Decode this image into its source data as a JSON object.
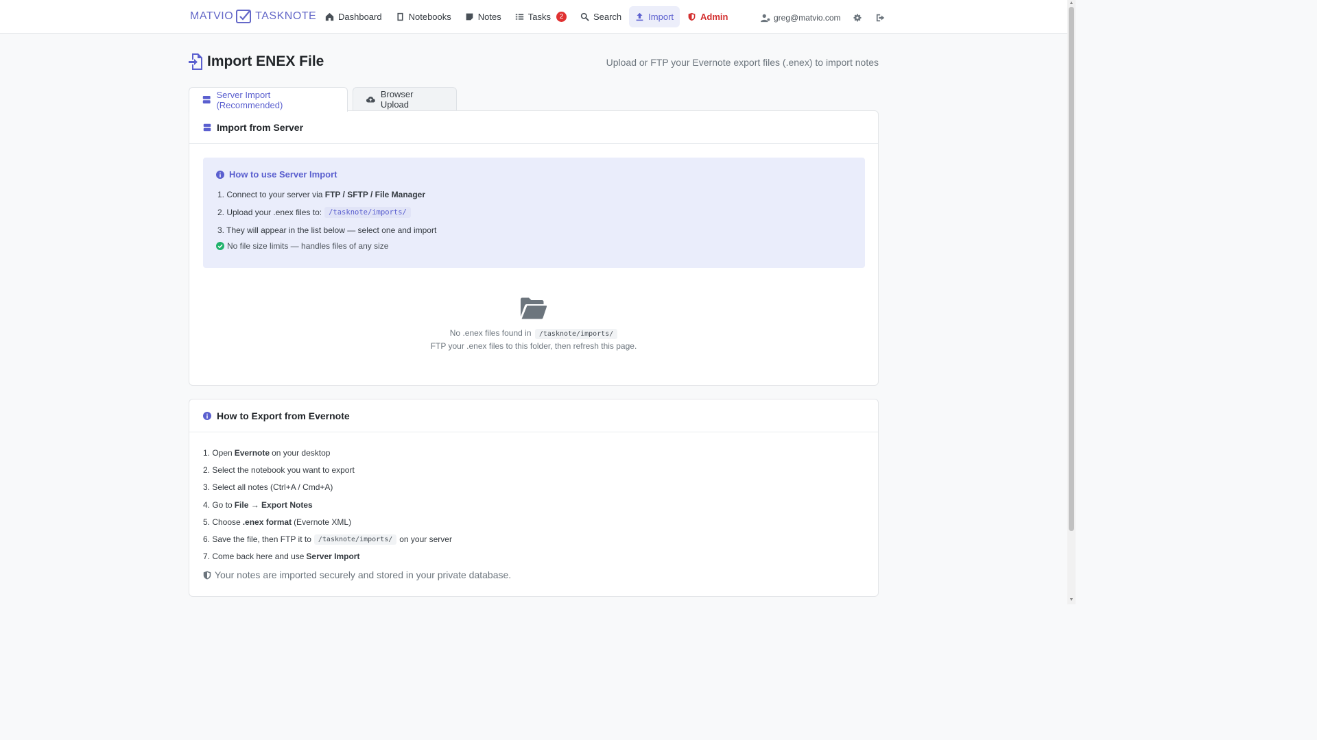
{
  "brand": {
    "left": "MATVIO",
    "right": "TASKNOTE"
  },
  "nav": {
    "dashboard": "Dashboard",
    "notebooks": "Notebooks",
    "notes": "Notes",
    "tasks": "Tasks",
    "tasks_badge": "2",
    "search": "Search",
    "import": "Import",
    "admin": "Admin",
    "user_email": "greg@matvio.com"
  },
  "page": {
    "title": "Import ENEX File",
    "subtitle": "Upload or FTP your Evernote export files (.enex) to import notes"
  },
  "tabs": {
    "server": "Server Import (Recommended)",
    "browser": "Browser Upload"
  },
  "server_card": {
    "title": "Import from Server",
    "info_title": "How to use Server Import",
    "step1_a": "1. Connect to your server via",
    "step1_b": "FTP / SFTP / File Manager",
    "step2_a": "2. Upload your .enex files to:",
    "step2_code": "/tasknote/imports/",
    "step3": "3. They will appear in the list below — select one and import",
    "note": "No file size limits — handles files of any size",
    "empty_line1": "No .enex files found in",
    "empty_code": "/tasknote/imports/",
    "empty_line2": "FTP your .enex files to this folder, then refresh this page."
  },
  "export_card": {
    "title": "How to Export from Evernote",
    "s1_a": "1. Open",
    "s1_b": "Evernote",
    "s1_c": "on your desktop",
    "s2": "2. Select the notebook you want to export",
    "s3": "3. Select all notes (Ctrl+A / Cmd+A)",
    "s4_a": "4. Go to",
    "s4_b": "File → Export Notes",
    "s5_a": "5. Choose",
    "s5_b": ".enex format",
    "s5_c": "(Evernote XML)",
    "s6_a": "6. Save the file, then FTP it to",
    "s6_code": "/tasknote/imports/",
    "s6_c": "on your server",
    "s7_a": "7. Come back here and use",
    "s7_b": "Server Import",
    "secure": "Your notes are imported securely and stored in your private database."
  },
  "colors": {
    "accent": "#5a5fcf",
    "danger": "#d32f2f",
    "success": "#20b26b"
  }
}
